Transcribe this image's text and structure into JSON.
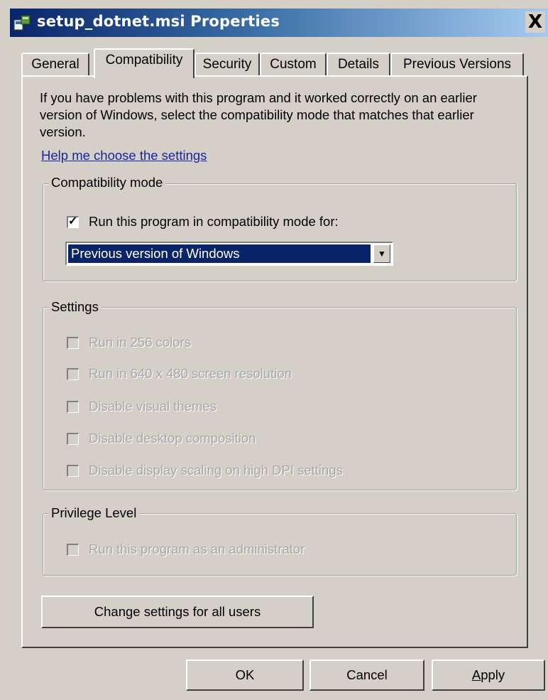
{
  "window": {
    "title": "setup_dotnet.msi Properties",
    "close_glyph": "X"
  },
  "tabs": [
    {
      "label": "General"
    },
    {
      "label": "Compatibility",
      "active": true
    },
    {
      "label": "Security"
    },
    {
      "label": "Custom"
    },
    {
      "label": "Details"
    },
    {
      "label": "Previous Versions"
    }
  ],
  "intro_text": "If you have problems with this program and it worked correctly on an earlier version of Windows, select the compatibility mode that matches that earlier version.",
  "help_link": "Help me choose the settings",
  "compat_mode": {
    "group_label": "Compatibility mode",
    "checkbox_label": "Run this program in compatibility mode for:",
    "checked": true,
    "selected_option": "Previous version of Windows"
  },
  "settings": {
    "group_label": "Settings",
    "items": [
      {
        "label": "Run in 256 colors",
        "checked": false,
        "disabled": true
      },
      {
        "label": "Run in 640 x 480 screen resolution",
        "checked": false,
        "disabled": true
      },
      {
        "label": "Disable visual themes",
        "checked": false,
        "disabled": true
      },
      {
        "label": "Disable desktop composition",
        "checked": false,
        "disabled": true
      },
      {
        "label": "Disable display scaling on high DPI settings",
        "checked": false,
        "disabled": true
      }
    ]
  },
  "privilege": {
    "group_label": "Privilege Level",
    "checkbox_label": "Run this program as an administrator",
    "checked": false,
    "disabled": true
  },
  "change_all_users_button": "Change settings for all users",
  "buttons": {
    "ok": "OK",
    "cancel": "Cancel",
    "apply_accel": "A",
    "apply_rest": "pply"
  },
  "colors": {
    "titlebar_start": "#0a246a",
    "titlebar_end": "#a6caf0",
    "selection": "#0a246a",
    "link": "#1a23a8",
    "face": "#d4d0c8"
  }
}
